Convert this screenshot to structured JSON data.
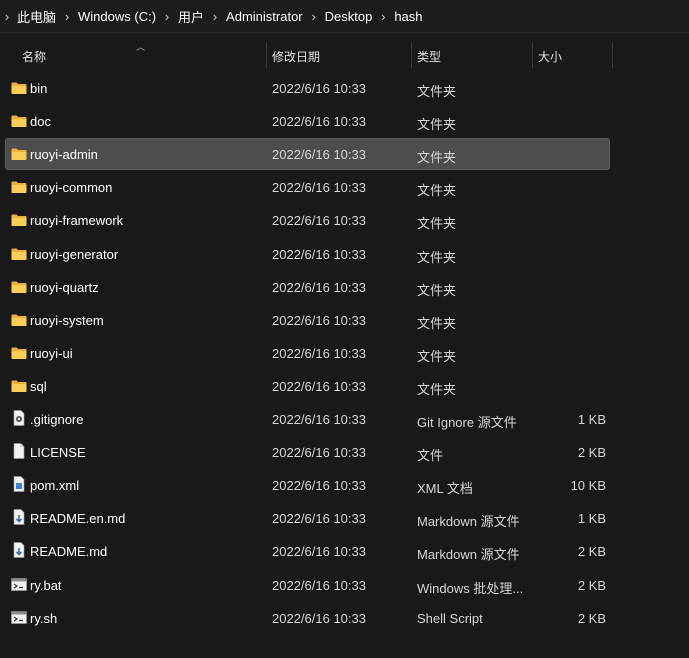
{
  "breadcrumb": [
    "此电脑",
    "Windows (C:)",
    "用户",
    "Administrator",
    "Desktop",
    "hash"
  ],
  "columns": {
    "name": "名称",
    "date": "修改日期",
    "type": "类型",
    "size": "大小"
  },
  "files": [
    {
      "name": "bin",
      "date": "2022/6/16 10:33",
      "type": "文件夹",
      "size": "",
      "icon": "folder-icon"
    },
    {
      "name": "doc",
      "date": "2022/6/16 10:33",
      "type": "文件夹",
      "size": "",
      "icon": "folder-icon"
    },
    {
      "name": "ruoyi-admin",
      "date": "2022/6/16 10:33",
      "type": "文件夹",
      "size": "",
      "icon": "folder-icon",
      "selected": true
    },
    {
      "name": "ruoyi-common",
      "date": "2022/6/16 10:33",
      "type": "文件夹",
      "size": "",
      "icon": "folder-icon"
    },
    {
      "name": "ruoyi-framework",
      "date": "2022/6/16 10:33",
      "type": "文件夹",
      "size": "",
      "icon": "folder-icon"
    },
    {
      "name": "ruoyi-generator",
      "date": "2022/6/16 10:33",
      "type": "文件夹",
      "size": "",
      "icon": "folder-icon"
    },
    {
      "name": "ruoyi-quartz",
      "date": "2022/6/16 10:33",
      "type": "文件夹",
      "size": "",
      "icon": "folder-icon"
    },
    {
      "name": "ruoyi-system",
      "date": "2022/6/16 10:33",
      "type": "文件夹",
      "size": "",
      "icon": "folder-icon"
    },
    {
      "name": "ruoyi-ui",
      "date": "2022/6/16 10:33",
      "type": "文件夹",
      "size": "",
      "icon": "folder-icon"
    },
    {
      "name": "sql",
      "date": "2022/6/16 10:33",
      "type": "文件夹",
      "size": "",
      "icon": "folder-icon"
    },
    {
      "name": ".gitignore",
      "date": "2022/6/16 10:33",
      "type": "Git Ignore 源文件",
      "size": "1 KB",
      "icon": "settings-file-icon"
    },
    {
      "name": "LICENSE",
      "date": "2022/6/16 10:33",
      "type": "文件",
      "size": "2 KB",
      "icon": "blank-file-icon"
    },
    {
      "name": "pom.xml",
      "date": "2022/6/16 10:33",
      "type": "XML 文档",
      "size": "10 KB",
      "icon": "xml-file-icon"
    },
    {
      "name": "README.en.md",
      "date": "2022/6/16 10:33",
      "type": "Markdown 源文件",
      "size": "1 KB",
      "icon": "markdown-file-icon"
    },
    {
      "name": "README.md",
      "date": "2022/6/16 10:33",
      "type": "Markdown 源文件",
      "size": "2 KB",
      "icon": "markdown-file-icon"
    },
    {
      "name": "ry.bat",
      "date": "2022/6/16 10:33",
      "type": "Windows 批处理...",
      "size": "2 KB",
      "icon": "script-file-icon"
    },
    {
      "name": "ry.sh",
      "date": "2022/6/16 10:33",
      "type": "Shell Script",
      "size": "2 KB",
      "icon": "script-file-icon"
    }
  ],
  "colors": {
    "background": "#191919",
    "selected_row": "#4d4d4d",
    "folder": "#e8b23a"
  }
}
